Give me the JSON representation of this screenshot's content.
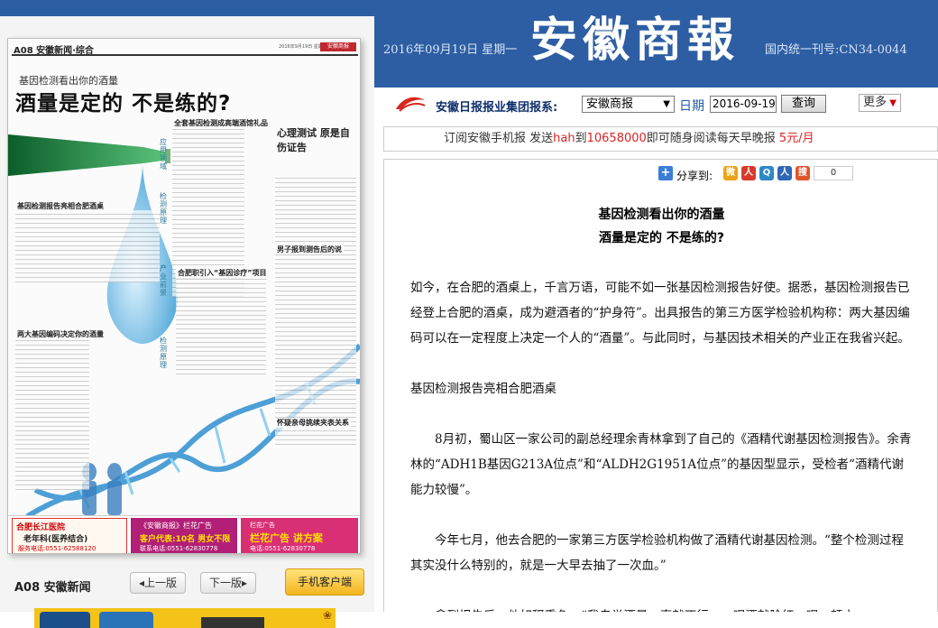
{
  "header": {
    "date": "2016年09月19日 星期一",
    "logo": "安徽商報",
    "issn": "国内统一刊号:CN34-0044"
  },
  "thumbnail": {
    "page_code": "A08 安徽新闻·综合",
    "date_small": "2016年9月19日 星期一",
    "badge": "安徽商报",
    "subtitle": "基因检测看出你的酒量",
    "title": "酒量是定的 不是练的?",
    "heads": [
      "基因检测报告亮相合肥酒桌",
      "两大基因编码决定你的酒量",
      "全套基因检测成高端酒馆礼品",
      "心理测试 原是自伤证告",
      "合肥职引入“基因诊疗”项目",
      "男子报到测告后的说",
      "怀疑亲母挑续夹表关系"
    ],
    "side_labels": [
      "应用领域",
      "检测原理",
      "产业前景",
      "检测原理"
    ],
    "ads": {
      "ad1": {
        "line1": "合肥长江医院",
        "line2": "老年科(医养结合)",
        "line3": "服务电话:0551-62588120"
      },
      "ad2": {
        "line1": "《安徽商报》栏花广告",
        "line2": "客户代表:10名 男女不限",
        "line3": "联系电话:0551-62830778"
      },
      "ad3": {
        "line1": "栏花广告",
        "line2": "栏花广告 讲方案",
        "line3": "电话:0551-62830778"
      }
    }
  },
  "pager": {
    "page_label": "A08 安徽新闻",
    "prev": "上一版",
    "next": "下一版",
    "mobile": "手机客户端"
  },
  "nav": {
    "group_label": "安徽日报报业集团报系:",
    "paper_select": "安徽商报",
    "date_label": "日期",
    "date_value": "2016-09-19",
    "query_btn": "查询",
    "more_btn": "更多"
  },
  "subscribe": {
    "text1": "订阅安徽手机报  发送",
    "code": "hah",
    "text2": "到",
    "number": "10658000",
    "text3": "即可随身阅读每天早晚报  ",
    "price": "5元/月"
  },
  "share": {
    "label": "分享到:",
    "count": "0",
    "icons": [
      "weibo-icon",
      "renren-icon",
      "qq-icon",
      "people-icon",
      "sohu-icon"
    ]
  },
  "article": {
    "subtitle": "基因检测看出你的酒量",
    "title": "酒量是定的 不是练的?",
    "p1": "如今，在合肥的酒桌上，千言万语，可能不如一张基因检测报告好使。据悉，基因检测报告已经登上合肥的酒桌，成为避酒者的“护身符”。出具报告的第三方医学检验机构称：两大基因编码可以在一定程度上决定一个人的“酒量”。与此同时，与基因技术相关的产业正在我省兴起。",
    "p2": "基因检测报告亮相合肥酒桌",
    "p3": "8月初，蜀山区一家公司的副总经理余青林拿到了自己的《酒精代谢基因检测报告》。余青林的“ADH1B基因G213A位点”和“ALDH2G1951A位点”的基因型显示，受检者“酒精代谢能力较慢”。",
    "p4": "今年七月，他去合肥的一家第三方医学检验机构做了酒精代谢基因检测。“整个检测过程其实没什么特别的，就是一大早去抽了一次血。”",
    "p5": "拿到报告后，他如释重负。“我自觉酒量一直就不行。一喝酒就脸红，喝一顿大"
  },
  "colors": {
    "header_bg": "#2d5ea3",
    "accent_red": "#d22222",
    "nav_text": "#0e2f6b"
  }
}
